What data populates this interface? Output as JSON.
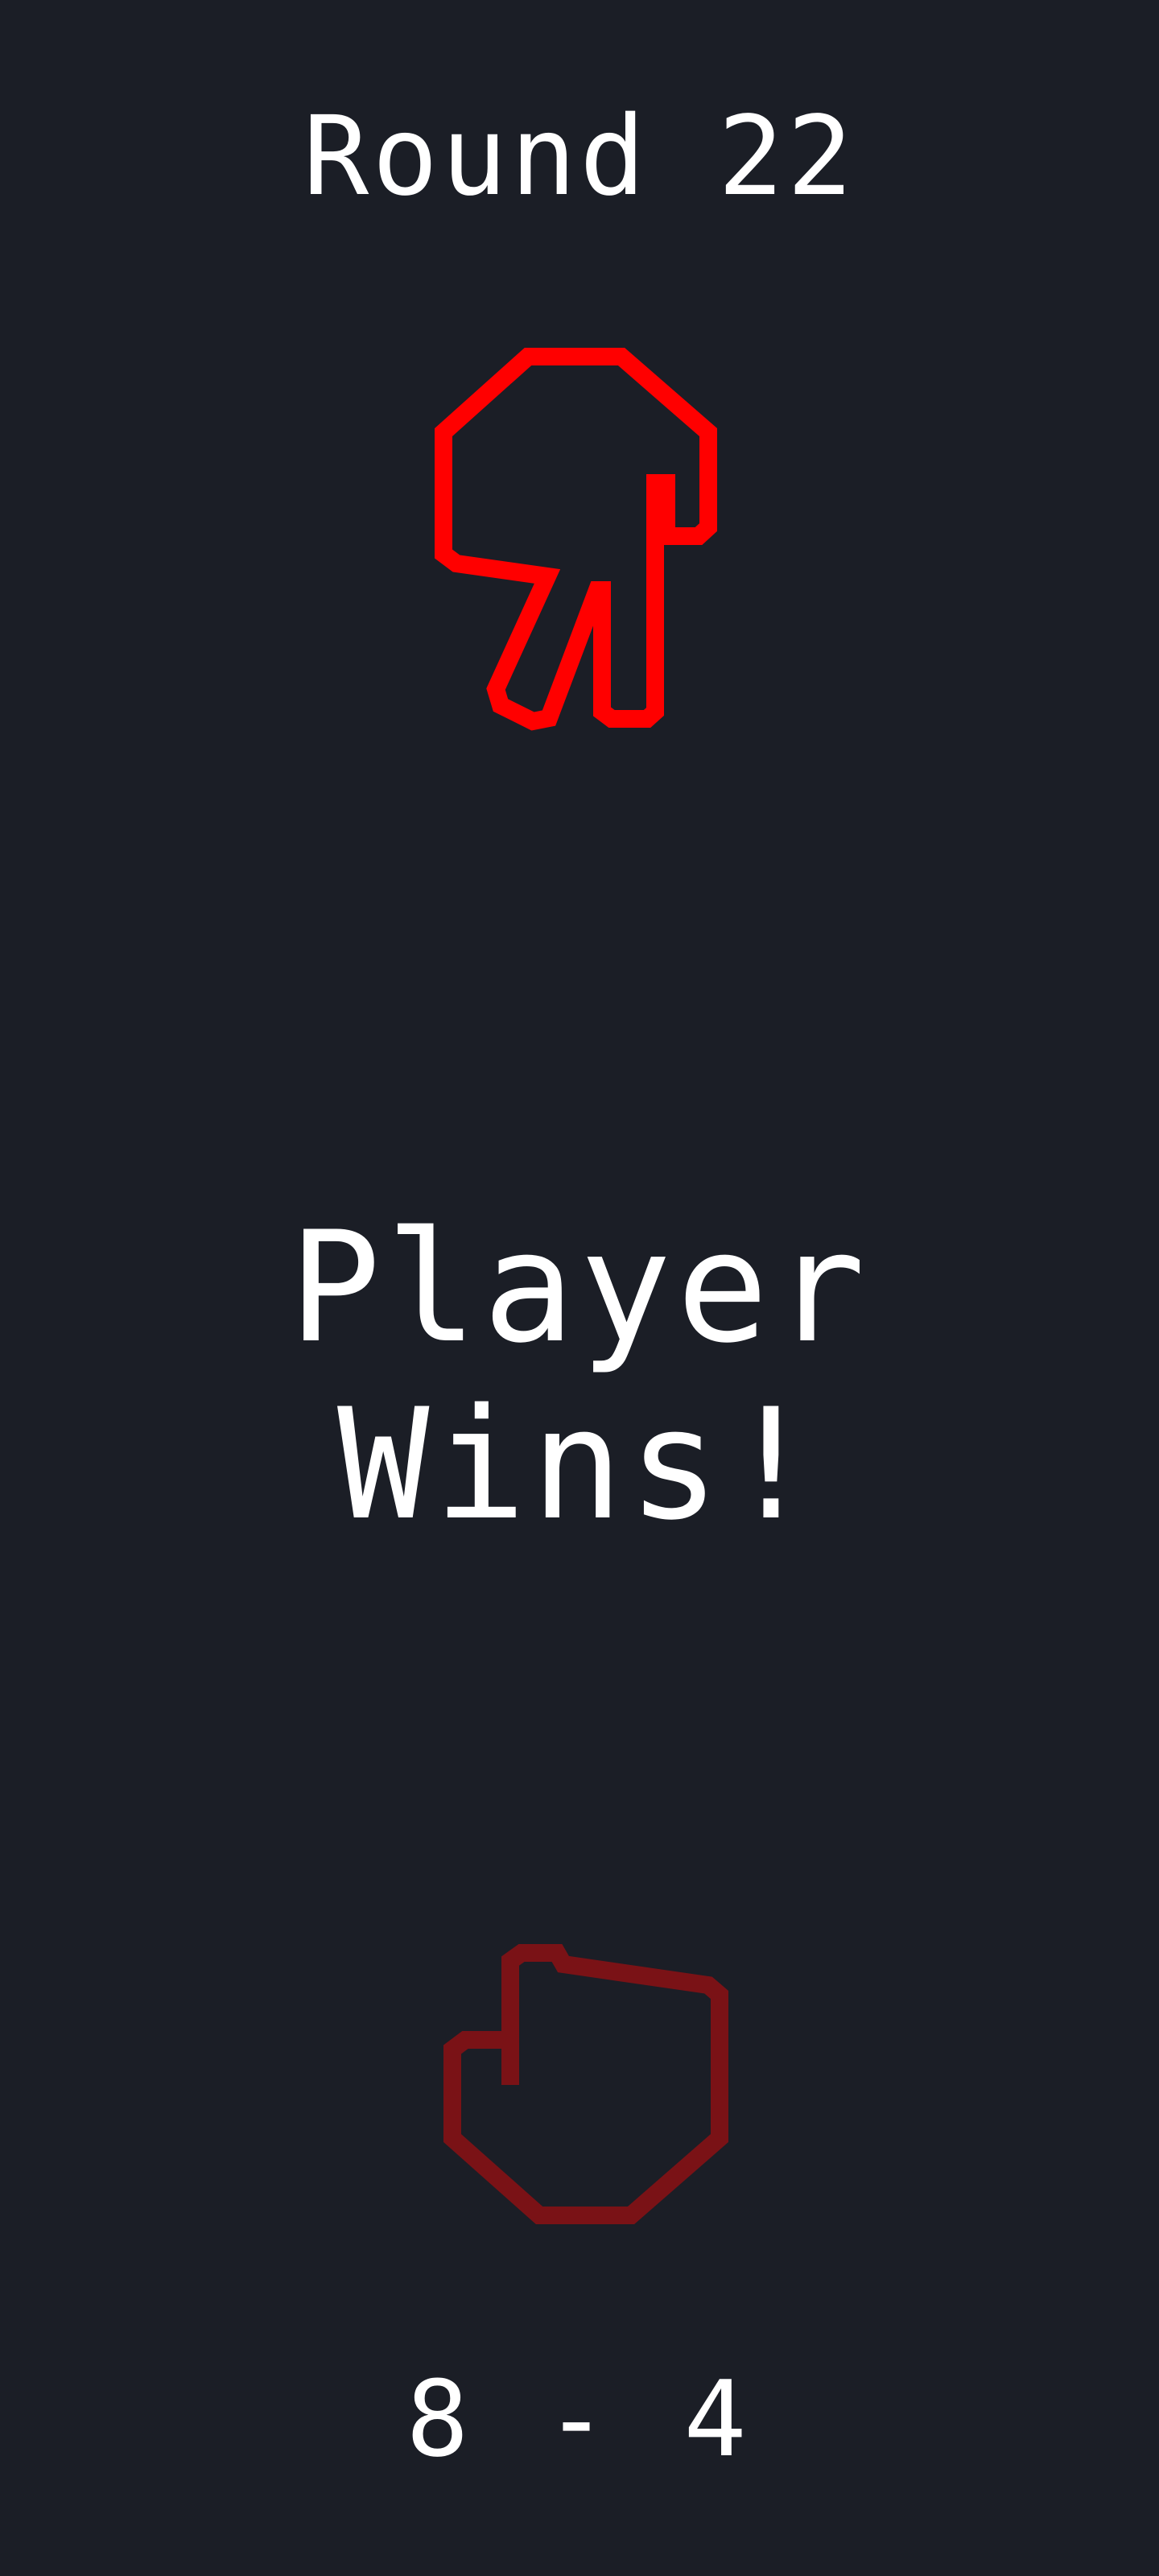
{
  "round": {
    "label": "Round 22"
  },
  "opponent_hand": {
    "icon": "scissors-hand-icon",
    "color": "#ff0000"
  },
  "result": {
    "text": "Player Wins!"
  },
  "player_hand": {
    "icon": "rock-fist-hand-icon",
    "color": "#7a1216"
  },
  "score": {
    "text": "8 - 4"
  },
  "colors": {
    "background": "#1b1e26",
    "text": "#ffffff"
  }
}
